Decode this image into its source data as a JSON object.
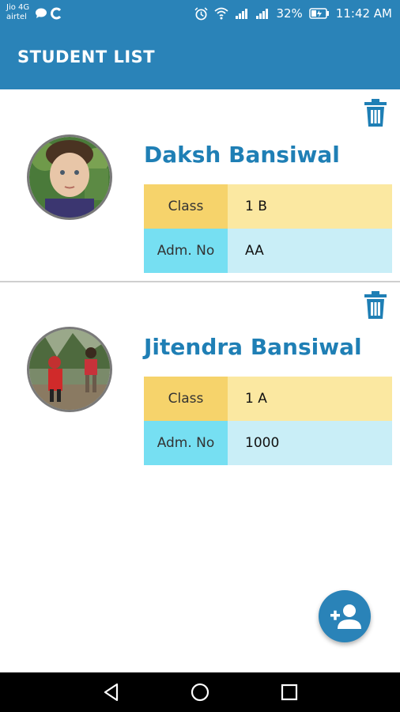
{
  "status_bar": {
    "carrier_line1": "Jio 4G",
    "carrier_line2": "airtel",
    "battery": "32%",
    "time": "11:42 AM"
  },
  "app_bar": {
    "title": "STUDENT LIST"
  },
  "students": [
    {
      "name": "Daksh Bansiwal",
      "class_label": "Class",
      "class_value": "1 B",
      "adm_label": "Adm. No",
      "adm_value": "AA"
    },
    {
      "name": "Jitendra Bansiwal",
      "class_label": "Class",
      "class_value": "1 A",
      "adm_label": "Adm. No",
      "adm_value": "1000"
    }
  ],
  "icons": {
    "delete": "trash-icon",
    "add_student": "person-add-icon",
    "nav_back": "back-triangle-icon",
    "nav_home": "home-circle-icon",
    "nav_recents": "recents-square-icon"
  },
  "colors": {
    "primary": "#2a83b8",
    "name_text": "#1f7fb5",
    "class_label_bg": "#f6d36b",
    "class_value_bg": "#fbe8a1",
    "adm_label_bg": "#76dff2",
    "adm_value_bg": "#c9eef7"
  }
}
